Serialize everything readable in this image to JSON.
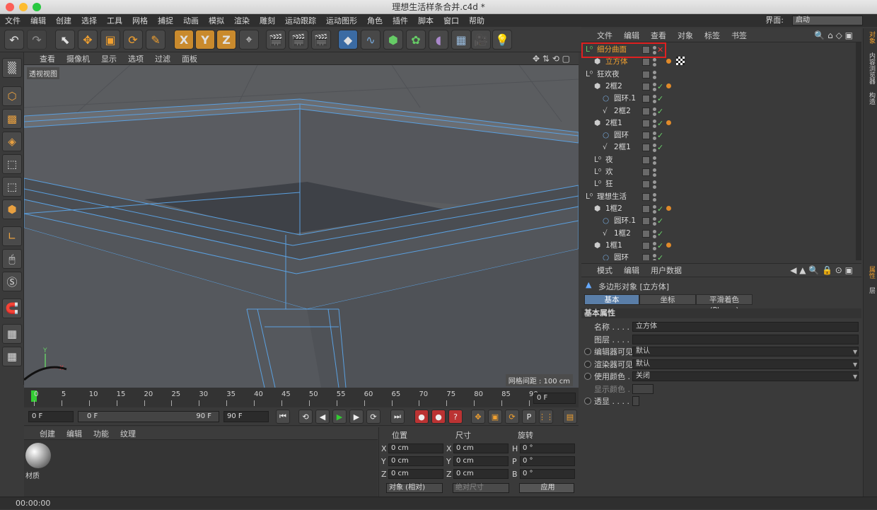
{
  "window": {
    "title": "理想生活样条合并.c4d *"
  },
  "menubar": {
    "items": [
      "文件",
      "编辑",
      "创建",
      "选择",
      "工具",
      "网格",
      "捕捉",
      "动画",
      "模拟",
      "渲染",
      "雕刻",
      "运动跟踪",
      "运动图形",
      "角色",
      "插件",
      "脚本",
      "窗口",
      "帮助"
    ],
    "layout_label": "界面:",
    "layout_value": "启动"
  },
  "viewport": {
    "menu": [
      "查看",
      "摄像机",
      "显示",
      "选项",
      "过滤",
      "面板"
    ],
    "label": "透视视图",
    "grid_spacing": "网格间距 : 100 cm"
  },
  "timeline": {
    "ticks": [
      "0",
      "5",
      "10",
      "15",
      "20",
      "25",
      "30",
      "35",
      "40",
      "45",
      "50",
      "55",
      "60",
      "65",
      "70",
      "75",
      "80",
      "85",
      "90"
    ],
    "current_frame_field": "0 F",
    "start_field": "0 F",
    "range_start": "0 F",
    "range_end": "90 F",
    "end_field": "90 F"
  },
  "material": {
    "menu": [
      "创建",
      "编辑",
      "功能",
      "纹理"
    ],
    "item_label": "材质"
  },
  "coords": {
    "headers": [
      "位置",
      "尺寸",
      "旋转"
    ],
    "rows": [
      {
        "a": "X",
        "pos": "0 cm",
        "b": "X",
        "size": "0 cm",
        "c": "H",
        "rot": "0 °"
      },
      {
        "a": "Y",
        "pos": "0 cm",
        "b": "Y",
        "size": "0 cm",
        "c": "P",
        "rot": "0 °"
      },
      {
        "a": "Z",
        "pos": "0 cm",
        "b": "Z",
        "size": "0 cm",
        "c": "B",
        "rot": "0 °"
      }
    ],
    "mode": "对象 (相对)",
    "size_mode": "绝对尺寸",
    "apply": "应用"
  },
  "status": {
    "time": "00:00:00"
  },
  "object_manager": {
    "menu": [
      "文件",
      "编辑",
      "查看",
      "对象",
      "标签",
      "书签"
    ],
    "objects": [
      {
        "name": "细分曲面",
        "indent": 0,
        "highlight": true,
        "tag": false,
        "check": false,
        "x": true
      },
      {
        "name": "立方体",
        "indent": 1,
        "orange": true,
        "tag": true,
        "check": false
      },
      {
        "name": "狂欢夜",
        "indent": 0,
        "tag": false,
        "check": false
      },
      {
        "name": "2框2",
        "indent": 1,
        "tag": true,
        "check": true
      },
      {
        "name": "圆环.1",
        "indent": 2,
        "tag": false,
        "check": true
      },
      {
        "name": "2框2",
        "indent": 2,
        "tag": false,
        "check": true
      },
      {
        "name": "2框1",
        "indent": 1,
        "tag": true,
        "check": true
      },
      {
        "name": "圆环",
        "indent": 2,
        "tag": false,
        "check": true
      },
      {
        "name": "2框1",
        "indent": 2,
        "tag": false,
        "check": true
      },
      {
        "name": "夜",
        "indent": 1,
        "tag": false,
        "check": false
      },
      {
        "name": "欢",
        "indent": 1,
        "tag": false,
        "check": false
      },
      {
        "name": "狂",
        "indent": 1,
        "tag": false,
        "check": false
      },
      {
        "name": "理想生活",
        "indent": 0,
        "tag": false,
        "check": false
      },
      {
        "name": "1框2",
        "indent": 1,
        "tag": true,
        "check": true
      },
      {
        "name": "圆环.1",
        "indent": 2,
        "tag": false,
        "check": true
      },
      {
        "name": "1框2",
        "indent": 2,
        "tag": false,
        "check": true
      },
      {
        "name": "1框1",
        "indent": 1,
        "tag": true,
        "check": true
      },
      {
        "name": "圆环",
        "indent": 2,
        "tag": false,
        "check": true
      }
    ]
  },
  "right_tabs": [
    "对象",
    "内容浏览器",
    "构造",
    "属性",
    "层"
  ],
  "attributes": {
    "menu": [
      "模式",
      "编辑",
      "用户数据"
    ],
    "object_title": "多边形对象 [立方体]",
    "tabs": [
      "基本",
      "坐标",
      "平滑着色(Phong)"
    ],
    "section": "基本属性",
    "props": [
      {
        "label": "名称 . . . . .",
        "value": "立方体"
      },
      {
        "label": "图层 . . . . .",
        "value": ""
      },
      {
        "label": "编辑器可见",
        "value": "默认",
        "radio": true
      },
      {
        "label": "渲染器可见",
        "value": "默认",
        "radio": true
      },
      {
        "label": "使用颜色 .",
        "value": "关闭",
        "radio": true
      },
      {
        "label": "显示颜色 .",
        "value": ""
      },
      {
        "label": "透显 . . . . .",
        "value": "",
        "radio": true
      }
    ]
  }
}
